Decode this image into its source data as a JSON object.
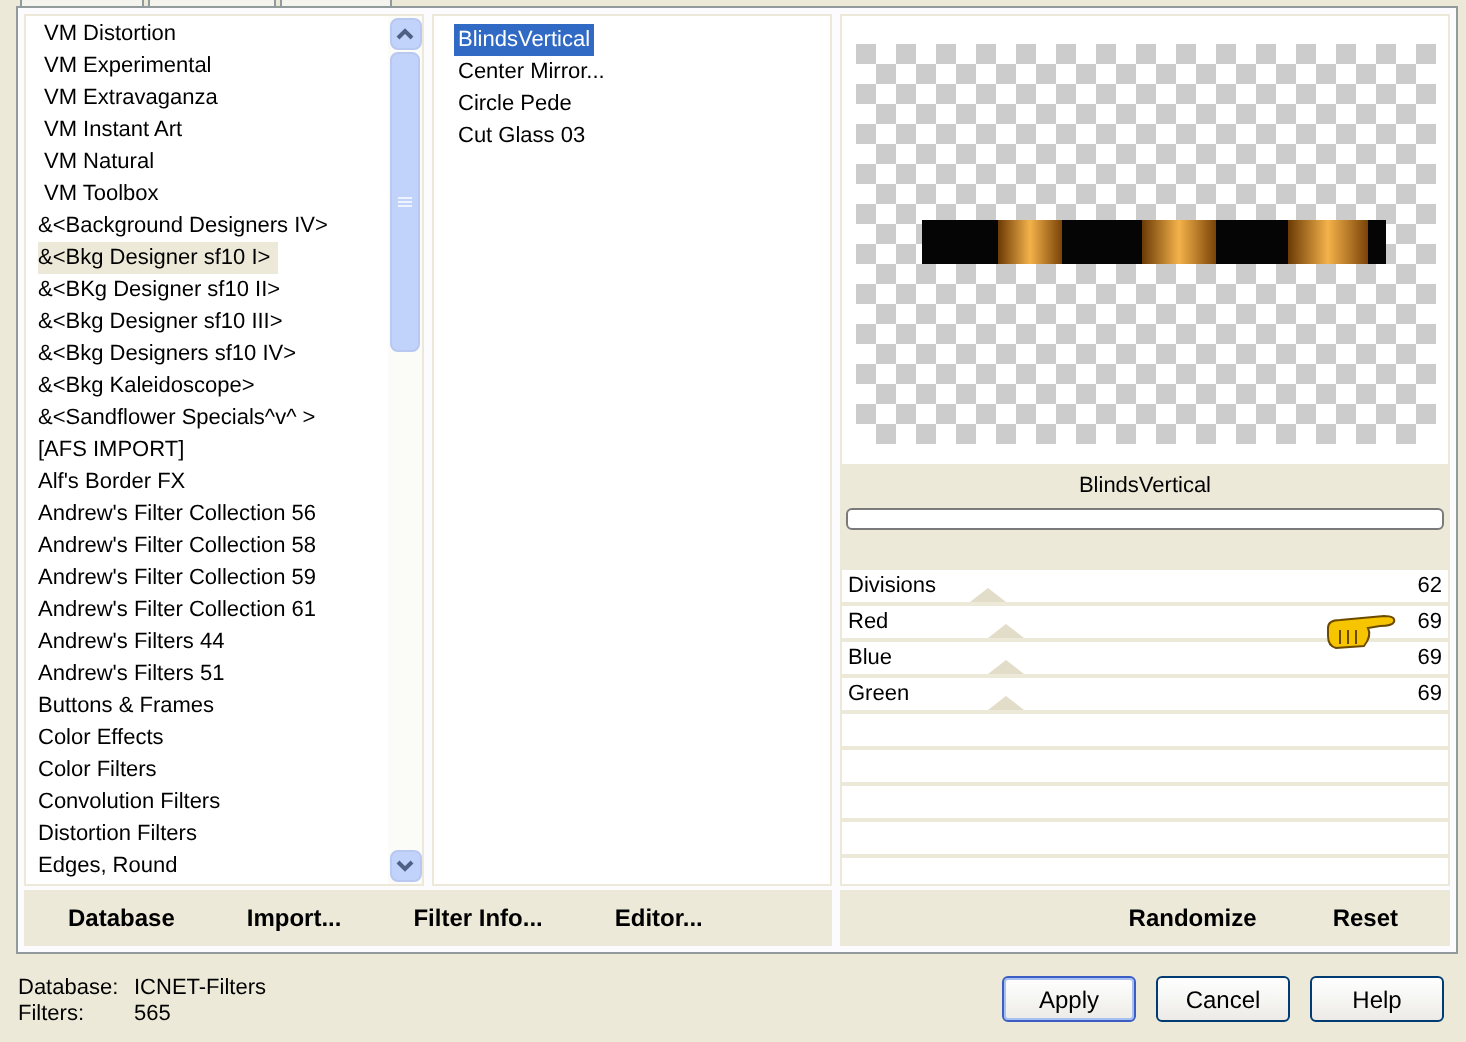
{
  "categories": [
    {
      "label": "VM Distortion",
      "selected": false
    },
    {
      "label": "VM Experimental",
      "selected": false
    },
    {
      "label": "VM Extravaganza",
      "selected": false
    },
    {
      "label": "VM Instant Art",
      "selected": false
    },
    {
      "label": "VM Natural",
      "selected": false
    },
    {
      "label": "VM Toolbox",
      "selected": false
    },
    {
      "label": "&<Background Designers IV>",
      "selected": false
    },
    {
      "label": "&<Bkg Designer sf10 I>",
      "selected": true
    },
    {
      "label": "&<BKg Designer sf10 II>",
      "selected": false
    },
    {
      "label": "&<Bkg Designer sf10 III>",
      "selected": false
    },
    {
      "label": "&<Bkg Designers sf10 IV>",
      "selected": false
    },
    {
      "label": "&<Bkg Kaleidoscope>",
      "selected": false
    },
    {
      "label": "&<Sandflower Specials^v^ >",
      "selected": false
    },
    {
      "label": "[AFS IMPORT]",
      "selected": false
    },
    {
      "label": "Alf's Border FX",
      "selected": false
    },
    {
      "label": "Andrew's Filter Collection 56",
      "selected": false
    },
    {
      "label": "Andrew's Filter Collection 58",
      "selected": false
    },
    {
      "label": "Andrew's Filter Collection 59",
      "selected": false
    },
    {
      "label": "Andrew's Filter Collection 61",
      "selected": false
    },
    {
      "label": "Andrew's Filters 44",
      "selected": false
    },
    {
      "label": "Andrew's Filters 51",
      "selected": false
    },
    {
      "label": "Buttons & Frames",
      "selected": false
    },
    {
      "label": "Color Effects",
      "selected": false
    },
    {
      "label": "Color Filters",
      "selected": false
    },
    {
      "label": "Convolution Filters",
      "selected": false
    },
    {
      "label": "Distortion Filters",
      "selected": false
    },
    {
      "label": "Edges, Round",
      "selected": false
    }
  ],
  "filters": [
    {
      "label": "BlindsVertical",
      "selected": true
    },
    {
      "label": "Center Mirror...",
      "selected": false
    },
    {
      "label": "Circle Pede",
      "selected": false
    },
    {
      "label": "Cut Glass 03",
      "selected": false
    }
  ],
  "filter_name": "BlindsVertical",
  "progress": {
    "level": 0
  },
  "parameters": [
    {
      "name": "Divisions",
      "value": "62",
      "level": 0.24
    },
    {
      "name": "Red",
      "value": "69",
      "level": 0.27
    },
    {
      "name": "Blue",
      "value": "69",
      "level": 0.27
    },
    {
      "name": "Green",
      "value": "69",
      "level": 0.27
    }
  ],
  "left_buttons": [
    "Database",
    "Import...",
    "Filter Info...",
    "Editor..."
  ],
  "right_buttons": [
    "Randomize",
    "Reset"
  ],
  "status": [
    {
      "label": "Database:",
      "value": "ICNET-Filters"
    },
    {
      "label": "Filters:",
      "value": "565"
    }
  ],
  "dialog_buttons": [
    {
      "label": "Apply",
      "default": true
    },
    {
      "label": "Cancel",
      "default": false
    },
    {
      "label": "Help",
      "default": false
    }
  ]
}
